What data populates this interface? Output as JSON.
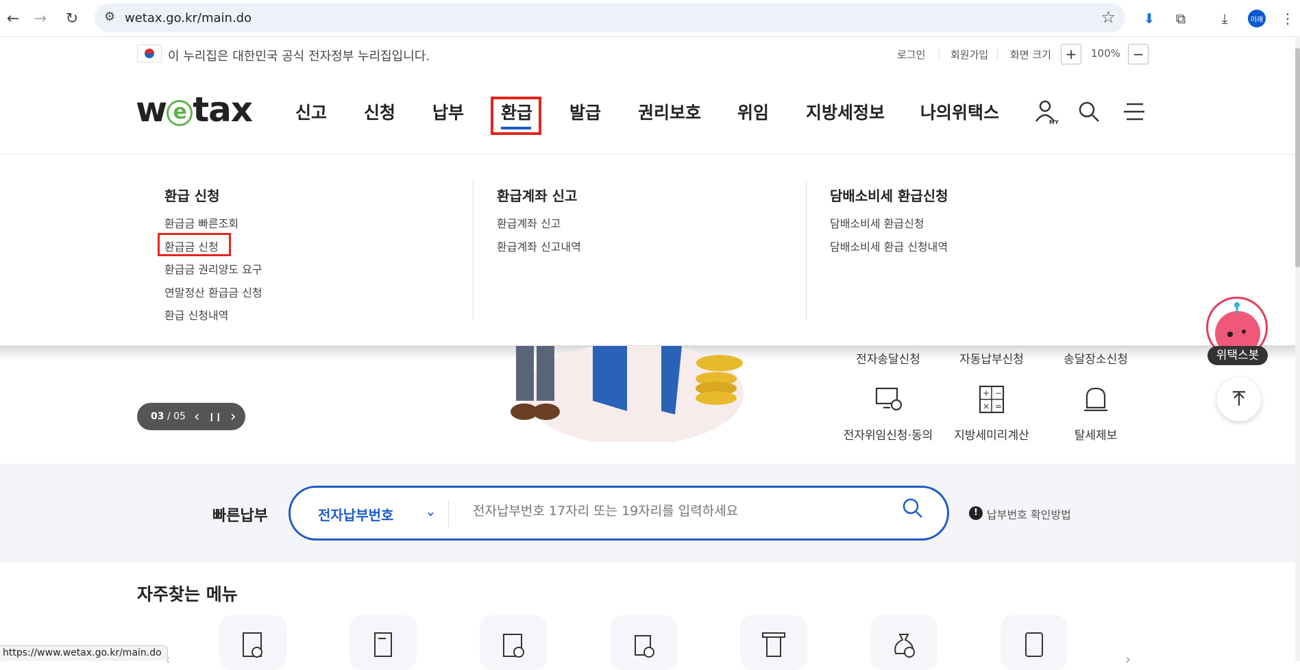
{
  "browser": {
    "url": "wetax.go.kr/main.do",
    "profile": "이래",
    "status_url": "https://www.wetax.go.kr/main.do"
  },
  "gov_banner": {
    "text": "이 누리집은 대한민국 공식 전자정부 누리집입니다.",
    "login": "로그인",
    "signup": "회원가입",
    "screen_size": "화면 크기",
    "zoom_in": "+",
    "zoom_level": "100%",
    "zoom_out": "−"
  },
  "logo": {
    "pre": "w",
    "e": "e",
    "post": "tax"
  },
  "gnb": [
    "신고",
    "신청",
    "납부",
    "환급",
    "발급",
    "권리보호",
    "위임",
    "지방세정보",
    "나의위택스"
  ],
  "gnb_active": "환급",
  "mega_menu": [
    {
      "title": "환급 신청",
      "items": [
        "환급금 빠른조회",
        "환급금 신청",
        "환급금 권리양도 요구",
        "연말정산 환급금 신청",
        "환급 신청내역"
      ]
    },
    {
      "title": "환급계좌 신고",
      "items": [
        "환급계좌 신고",
        "환급계좌 신고내역"
      ]
    },
    {
      "title": "담배소비세 환급신청",
      "items": [
        "담배소비세 환급신청",
        "담배소비세 환급 신청내역"
      ]
    }
  ],
  "slide": {
    "current": "03",
    "total": "/ 05",
    "prev": "‹",
    "pause": "❙❙",
    "next": "›"
  },
  "quick_links_top": [
    "전자송달신청",
    "자동납부신청",
    "송달장소신청"
  ],
  "quick_links_bottom": [
    "전자위임신청·동의",
    "지방세미리계산",
    "탈세제보"
  ],
  "quick_pay": {
    "title": "빠른납부",
    "select": "전자납부번호",
    "placeholder": "전자납부번호 17자리 또는 19자리를 입력하세요",
    "help": "납부번호 확인방법"
  },
  "freq_menu_title": "자주찾는 메뉴",
  "bot_label": "위택스봇",
  "colors": {
    "accent_blue": "#1b5bc9",
    "highlight_red": "#e1261c",
    "logo_green": "#5eb34c"
  }
}
